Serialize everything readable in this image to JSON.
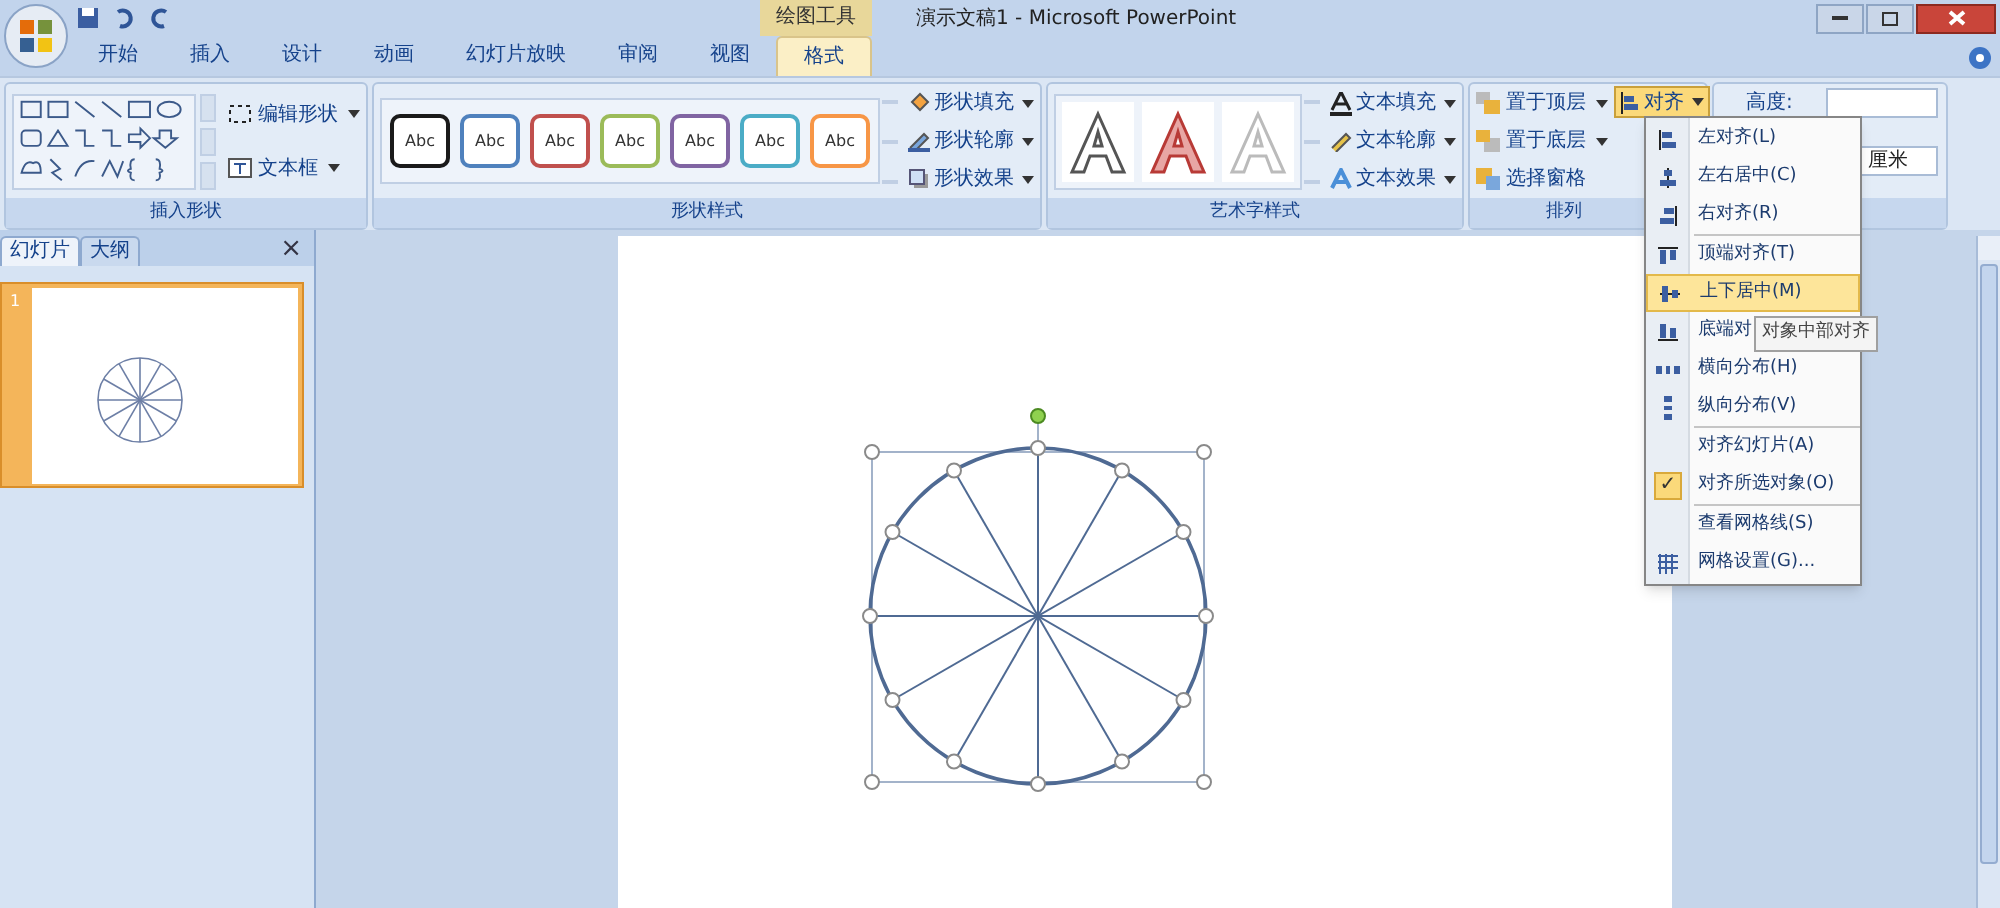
{
  "title_bar": {
    "context_label": "绘图工具",
    "title": "演示文稿1 - Microsoft PowerPoint"
  },
  "tabs": [
    {
      "label": "开始",
      "selected": false
    },
    {
      "label": "插入",
      "selected": false
    },
    {
      "label": "设计",
      "selected": false
    },
    {
      "label": "动画",
      "selected": false
    },
    {
      "label": "幻灯片放映",
      "selected": false
    },
    {
      "label": "审阅",
      "selected": false
    },
    {
      "label": "视图",
      "selected": false
    },
    {
      "label": "格式",
      "selected": true
    }
  ],
  "ribbon": {
    "insert_shapes": {
      "label": "插入形状",
      "commands": [
        "编辑形状",
        "文本框"
      ]
    },
    "shape_styles": {
      "label": "形状样式",
      "styles": [
        {
          "text": "Abc",
          "color": "#1a1a1a"
        },
        {
          "text": "Abc",
          "color": "#4f81bd"
        },
        {
          "text": "Abc",
          "color": "#c0504d"
        },
        {
          "text": "Abc",
          "color": "#9bbb59"
        },
        {
          "text": "Abc",
          "color": "#8064a2"
        },
        {
          "text": "Abc",
          "color": "#4bacc6"
        },
        {
          "text": "Abc",
          "color": "#f79646"
        }
      ],
      "commands": [
        "形状填充",
        "形状轮廓",
        "形状效果"
      ]
    },
    "wordart_styles": {
      "label": "艺术字样式",
      "commands": [
        "文本填充",
        "文本轮廓",
        "文本效果"
      ]
    },
    "arrange": {
      "label": "排列",
      "commands": [
        "置于顶层",
        "置于底层",
        "选择窗格"
      ],
      "align_button": "对齐"
    },
    "size": {
      "height_label": "高度:",
      "unit": "厘米"
    }
  },
  "left_panel": {
    "tabs": [
      {
        "label": "幻灯片",
        "selected": true
      },
      {
        "label": "大纲",
        "selected": false
      }
    ],
    "close": "×",
    "slide_number": "1"
  },
  "align_menu": {
    "items": [
      {
        "label": "左对齐(L)",
        "selected": false,
        "checked": false
      },
      {
        "label": "左右居中(C)",
        "selected": false,
        "checked": false
      },
      {
        "label": "右对齐(R)",
        "selected": false,
        "checked": false
      },
      {
        "label": "顶端对齐(T)",
        "selected": false,
        "checked": false
      },
      {
        "label": "上下居中(M)",
        "selected": true,
        "checked": false
      },
      {
        "label": "底端对",
        "selected": false,
        "checked": false
      },
      {
        "label": "横向分布(H)",
        "selected": false,
        "checked": false
      },
      {
        "label": "纵向分布(V)",
        "selected": false,
        "checked": false
      },
      {
        "label": "对齐幻灯片(A)",
        "selected": false,
        "checked": false
      },
      {
        "label": "对齐所选对象(O)",
        "selected": false,
        "checked": true
      },
      {
        "label": "查看网格线(S)",
        "selected": false,
        "checked": false
      },
      {
        "label": "网格设置(G)...",
        "selected": false,
        "checked": false
      }
    ],
    "check_glyph": "✓",
    "tooltip": "对象中部对齐"
  }
}
